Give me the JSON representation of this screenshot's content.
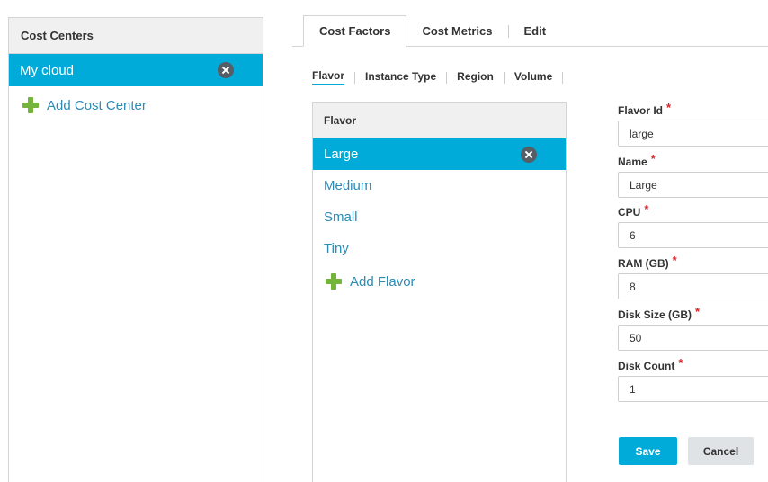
{
  "cost_centers": {
    "header": "Cost Centers",
    "items": [
      {
        "label": "My cloud",
        "selected": true
      }
    ],
    "add_label": "Add Cost Center"
  },
  "tabs": [
    {
      "label": "Cost Factors",
      "active": true
    },
    {
      "label": "Cost Metrics",
      "active": false
    },
    {
      "label": "Edit",
      "active": false
    }
  ],
  "subtabs": [
    {
      "label": "Flavor",
      "active": true
    },
    {
      "label": "Instance Type",
      "active": false
    },
    {
      "label": "Region",
      "active": false
    },
    {
      "label": "Volume",
      "active": false
    }
  ],
  "flavors": {
    "header": "Flavor",
    "items": [
      {
        "label": "Large",
        "selected": true
      },
      {
        "label": "Medium",
        "selected": false
      },
      {
        "label": "Small",
        "selected": false
      },
      {
        "label": "Tiny",
        "selected": false
      }
    ],
    "add_label": "Add Flavor"
  },
  "form": {
    "required_marker": "*",
    "fields": [
      {
        "label": "Flavor Id",
        "value": "large"
      },
      {
        "label": "Name",
        "value": "Large"
      },
      {
        "label": "CPU",
        "value": "6"
      },
      {
        "label": "RAM (GB)",
        "value": "8"
      },
      {
        "label": "Disk Size (GB)",
        "value": "50"
      },
      {
        "label": "Disk Count",
        "value": "1"
      }
    ],
    "save_label": "Save",
    "cancel_label": "Cancel"
  },
  "icons": {
    "remove": "close-circle-icon",
    "add": "plus-icon"
  },
  "colors": {
    "accent": "#00aad9",
    "link": "#2b8bb5",
    "add_icon": "#74b43a",
    "required": "#d9232a"
  }
}
